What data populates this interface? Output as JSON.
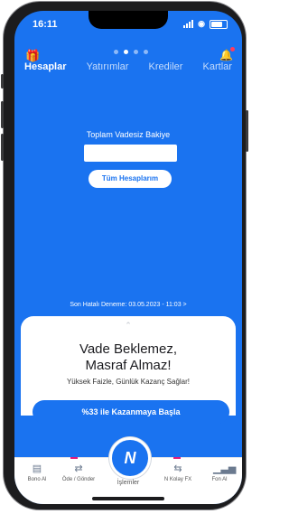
{
  "status": {
    "time": "16:11"
  },
  "header": {
    "tabs": [
      "Hesaplar",
      "Yatırımlar",
      "Krediler",
      "Kartlar"
    ],
    "active_tab": 0,
    "page_dots": 4,
    "active_dot": 1
  },
  "account": {
    "balance_label": "Toplam Vadesiz Bakiye",
    "all_accounts_label": "Tüm Hesaplarım",
    "last_login": "Son Hatalı Deneme: 03.05.2023 - 11:03 >"
  },
  "promo": {
    "title_line1": "Vade Beklemez,",
    "title_line2": "Masraf Almaz!",
    "subtitle": "Yüksek Faizle, Günlük Kazanç Sağlar!",
    "cta_label": "%33 ile Kazanmaya Başla"
  },
  "bottom_nav": {
    "items": [
      {
        "label": "Bono Al",
        "icon": "document-icon"
      },
      {
        "label": "Öde / Gönder",
        "icon": "transfer-icon"
      },
      {
        "label": "N Kolay FX",
        "icon": "currency-exchange-icon"
      },
      {
        "label": "Fon Al",
        "icon": "bar-chart-icon"
      }
    ],
    "center_label": "İşlemler",
    "center_glyph": "N"
  },
  "colors": {
    "brand_blue": "#1a73f0",
    "accent_pink": "#e0197d"
  }
}
